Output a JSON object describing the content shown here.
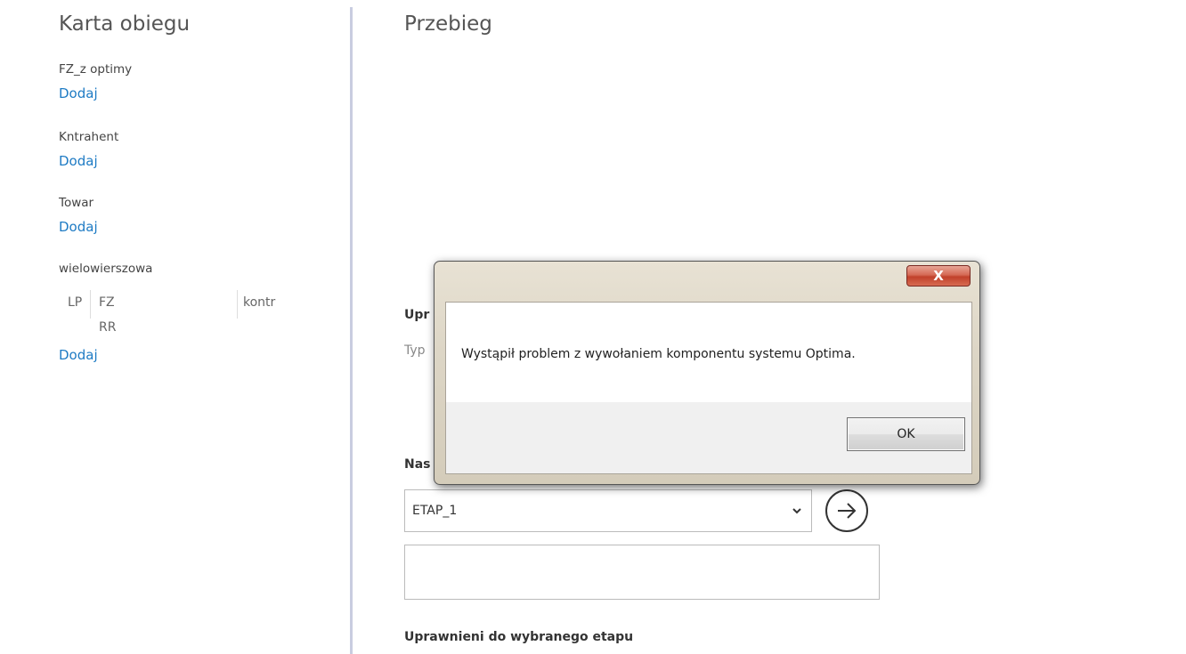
{
  "left_panel": {
    "title": "Karta obiegu",
    "fields": [
      {
        "label": "FZ_z optimy",
        "add": "Dodaj"
      },
      {
        "label": "Kntrahent",
        "add": "Dodaj"
      },
      {
        "label": "Towar",
        "add": "Dodaj"
      }
    ],
    "multirow": {
      "label": "wielowierszowa",
      "columns": [
        "LP",
        "FZ RR",
        "kontr"
      ],
      "add": "Dodaj"
    }
  },
  "right_panel": {
    "title": "Przebieg",
    "section_upr": "Upr",
    "type_hint": "Typ",
    "section_next": "Nas",
    "stage_select": {
      "value": "ETAP_1"
    },
    "permissions_label": "Uprawnieni do wybranego etapu"
  },
  "dialog": {
    "close_label": "X",
    "message": "Wystąpił problem z wywołaniem komponentu systemu Optima.",
    "ok_label": "OK"
  },
  "colors": {
    "link": "#1e7bc4",
    "divider": "#c9cde0",
    "close_button": "#c1402a"
  },
  "icons": {
    "go": "arrow-right-circle-icon",
    "dropdown": "chevron-down-icon",
    "close": "close-icon"
  }
}
